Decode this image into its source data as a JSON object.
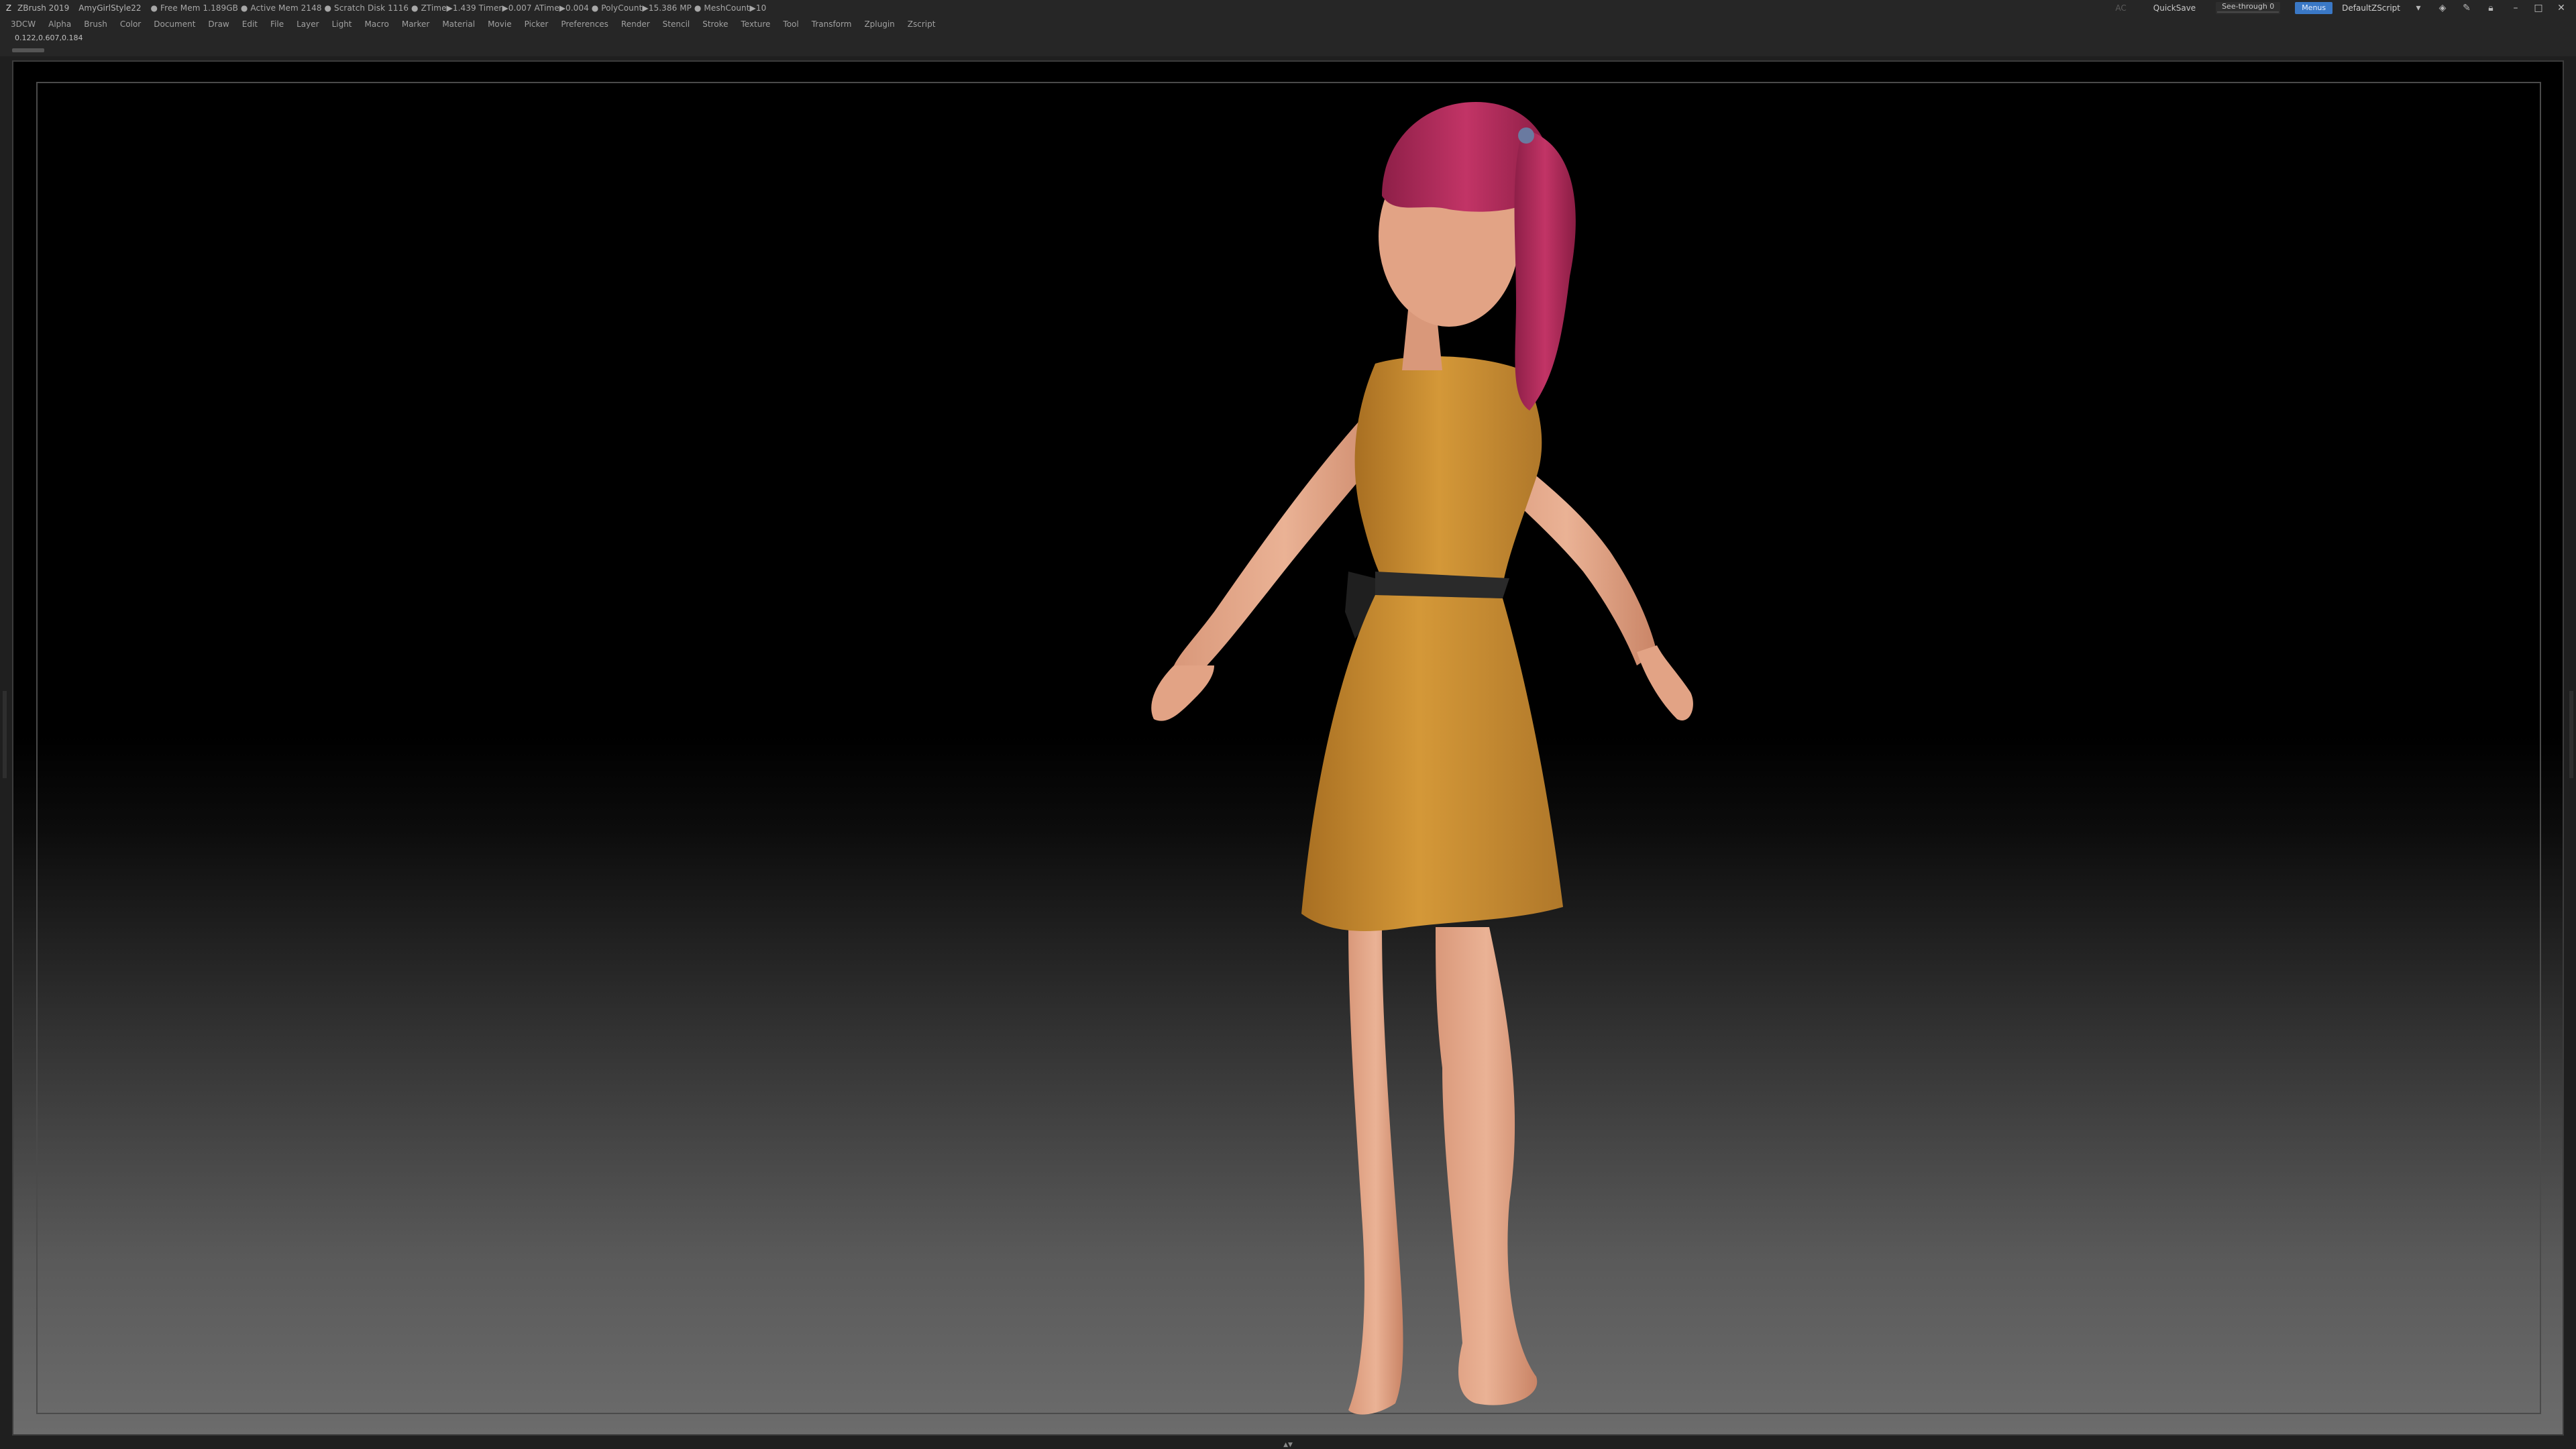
{
  "titlebar": {
    "app": "ZBrush 2019",
    "document": "AmyGirlStyle22",
    "info": "● Free Mem 1.189GB ● Active Mem 2148 ● Scratch Disk 1116 ● ZTime▶1.439 Timer▶0.007 ATime▶0.004 ● PolyCount▶15.386 MP ● MeshCount▶10",
    "ac": "AC",
    "quicksave": "QuickSave",
    "see_through": "See-through  0",
    "see_through_value": 0,
    "menus_button": "Menus",
    "default_zscript": "DefaultZScript"
  },
  "menubar": {
    "items": [
      "3DCW",
      "Alpha",
      "Brush",
      "Color",
      "Document",
      "Draw",
      "Edit",
      "File",
      "Layer",
      "Light",
      "Macro",
      "Marker",
      "Material",
      "Movie",
      "Picker",
      "Preferences",
      "Render",
      "Stencil",
      "Stroke",
      "Texture",
      "Tool",
      "Transform",
      "Zplugin",
      "Zscript"
    ]
  },
  "infostrip": {
    "coords": "0.122,0.607,0.184"
  },
  "colors": {
    "accent": "#3a78c6",
    "slider": "#e0a030",
    "dress": "#c8892e",
    "hair": "#b02a5a",
    "skin": "#e6a988",
    "belt": "#2a2a2a"
  },
  "icons": [
    "zbrush-logo-icon",
    "layout-icon",
    "palette-icon",
    "lock-icon",
    "minimize-icon",
    "maximize-icon",
    "close-icon"
  ]
}
